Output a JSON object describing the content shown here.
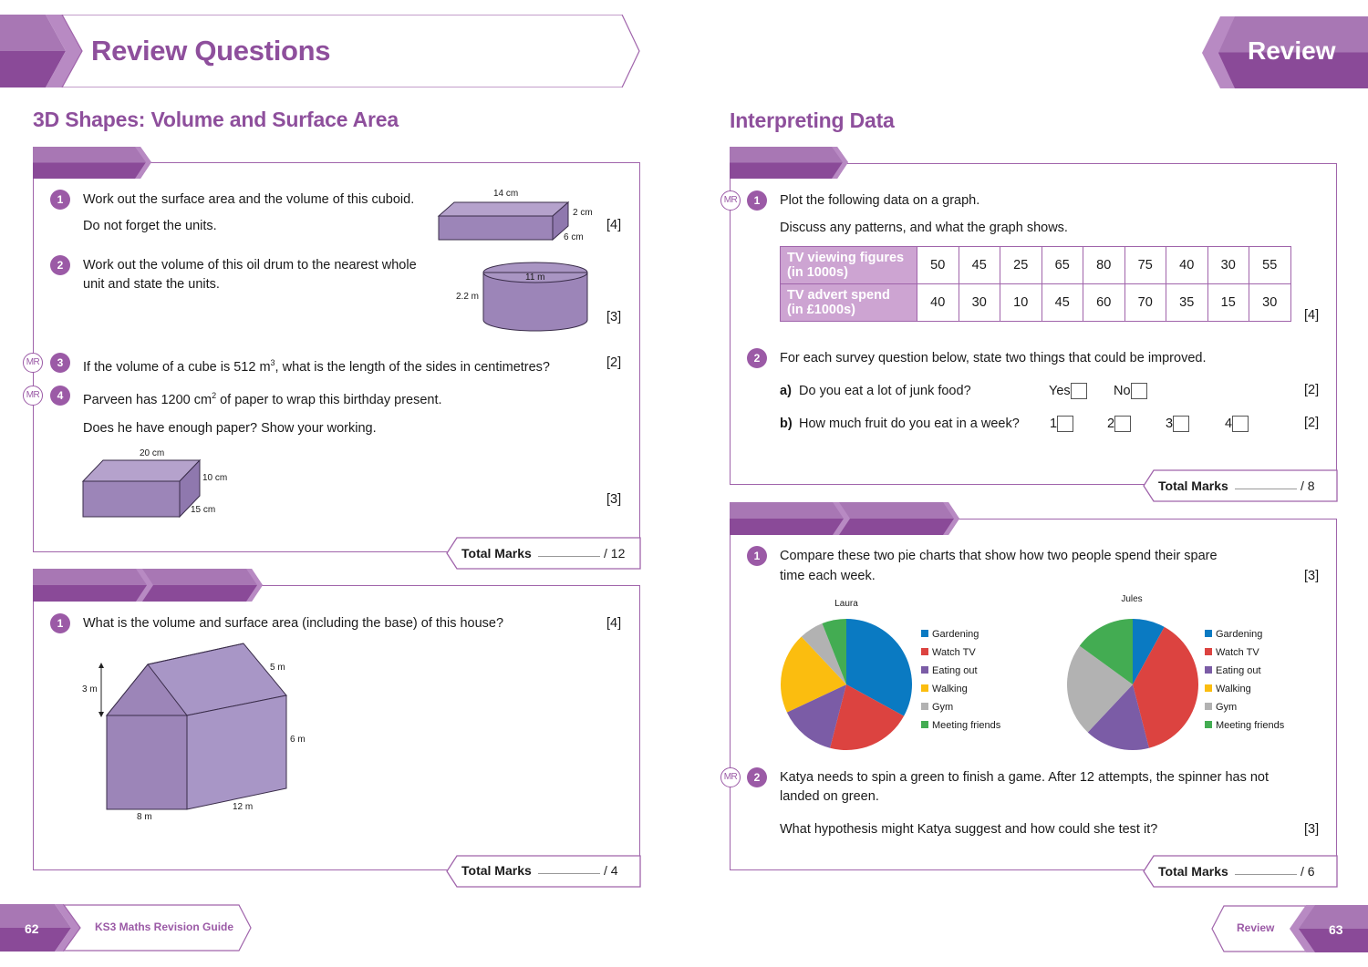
{
  "header": {
    "title": "Review Questions",
    "badge": "Review"
  },
  "left_page": {
    "section_title": "3D Shapes: Volume and Surface Area",
    "box1": {
      "questions": [
        {
          "number": "1",
          "lines": [
            "Work out the surface area and the volume of this cuboid.",
            "Do not forget the units."
          ],
          "marks": "[4]",
          "figure_labels": {
            "length": "14 cm",
            "height": "2 cm",
            "depth": "6 cm"
          }
        },
        {
          "number": "2",
          "lines": [
            "Work out the volume of this oil drum to the nearest whole",
            "unit and state the units."
          ],
          "marks": "[3]",
          "figure_labels": {
            "diameter": "11 m",
            "height": "2.2 m"
          }
        },
        {
          "number": "3",
          "mr": "MR",
          "text_pre": "If the volume of a cube is 512 m",
          "text_sup": "3",
          "text_post": ", what is the length of the sides in centimetres?",
          "marks": "[2]"
        },
        {
          "number": "4",
          "mr": "MR",
          "text_pre": "Parveen has 1200 cm",
          "text_sup": "2",
          "text_post": " of paper to wrap this birthday present.",
          "line2": "Does he have enough paper? Show your working.",
          "marks": "[3]",
          "figure_labels": {
            "length": "20 cm",
            "height": "10 cm",
            "depth": "15 cm"
          }
        }
      ],
      "total_label": "Total Marks",
      "total_max": "/ 12"
    },
    "box2": {
      "questions": [
        {
          "number": "1",
          "text": "What is the volume and surface area (including the base) of this house?",
          "marks": "[4]",
          "figure_labels": {
            "roof_height": "3 m",
            "roof_slope": "5 m",
            "wall_height": "6 m",
            "width": "8 m",
            "length": "12 m"
          }
        }
      ],
      "total_label": "Total Marks",
      "total_max": "/ 4"
    },
    "footer": {
      "page_number": "62",
      "book_title": "KS3 Maths Revision Guide"
    }
  },
  "right_page": {
    "section_title": "Interpreting Data",
    "box1": {
      "q1": {
        "number": "1",
        "mr": "MR",
        "line1": "Plot the following data on a graph.",
        "line2": "Discuss any patterns, and what the graph shows.",
        "marks": "[4]",
        "table": {
          "rows": [
            {
              "header_line1": "TV viewing figures",
              "header_line2": "(in 1000s)",
              "values": [
                "50",
                "45",
                "25",
                "65",
                "80",
                "75",
                "40",
                "30",
                "55"
              ]
            },
            {
              "header_line1": "TV advert spend",
              "header_line2": "(in £1000s)",
              "values": [
                "40",
                "30",
                "10",
                "45",
                "60",
                "70",
                "35",
                "15",
                "30"
              ]
            }
          ]
        }
      },
      "q2": {
        "number": "2",
        "text": "For each survey question below, state two things that could be improved.",
        "parts": [
          {
            "label": "a)",
            "text": "Do you eat a lot of junk food?",
            "options": [
              "Yes",
              "No"
            ],
            "marks": "[2]"
          },
          {
            "label": "b)",
            "text": "How much fruit do you eat in a week?",
            "options": [
              "1",
              "2",
              "3",
              "4"
            ],
            "marks": "[2]"
          }
        ]
      },
      "total_label": "Total Marks",
      "total_max": "/ 8"
    },
    "box2": {
      "q1": {
        "number": "1",
        "line1": "Compare these two pie charts that show how two people spend their spare",
        "line2": "time each week.",
        "marks": "[3]"
      },
      "q2": {
        "number": "2",
        "mr": "MR",
        "line1": "Katya needs to spin a green to finish a game. After 12 attempts, the spinner has not",
        "line2": "landed on green.",
        "line3": "What hypothesis might Katya suggest and how could she test it?",
        "marks": "[3]"
      },
      "total_label": "Total Marks",
      "total_max": "/ 6"
    },
    "footer": {
      "page_number": "63",
      "label": "Review"
    }
  },
  "colors": {
    "brand_purple": "#8e4f9c",
    "badge_purple": "#9b5aa6",
    "shape_fill": "#9c85b8",
    "table_header": "#cda4d2"
  },
  "chart_data": [
    {
      "type": "pie",
      "title": "Laura",
      "categories": [
        "Gardening",
        "Watch TV",
        "Eating out",
        "Walking",
        "Gym",
        "Meeting friends"
      ],
      "values": [
        33,
        21,
        14,
        20,
        6,
        6
      ],
      "colors": [
        "#0a7ac2",
        "#dc4340",
        "#7b5ca6",
        "#fbbd0f",
        "#b2b2b2",
        "#43ac52"
      ],
      "legend": "right",
      "start_angle": "12 o'clock, clockwise"
    },
    {
      "type": "pie",
      "title": "Jules",
      "categories": [
        "Gardening",
        "Watch TV",
        "Eating out",
        "Walking",
        "Gym",
        "Meeting friends"
      ],
      "values": [
        8,
        38,
        16,
        0,
        23,
        15
      ],
      "colors": [
        "#0a7ac2",
        "#dc4340",
        "#7b5ca6",
        "#fbbd0f",
        "#b2b2b2",
        "#43ac52"
      ],
      "legend": "right",
      "start_angle": "12 o'clock, clockwise"
    }
  ]
}
